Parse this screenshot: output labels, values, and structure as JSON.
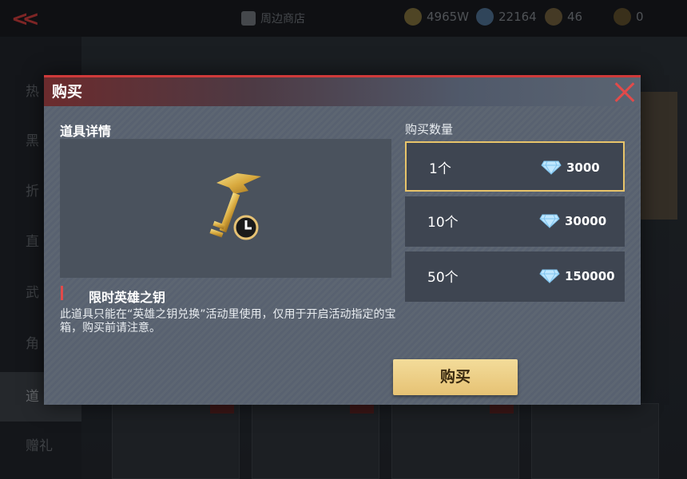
{
  "top_bar": {
    "shop_label": "周边商店",
    "currencies": [
      {
        "icon": "gold-coin-icon",
        "value": "4965W"
      },
      {
        "icon": "diamond-icon",
        "value": "22164"
      },
      {
        "icon": "cf-point-icon",
        "value": "46"
      },
      {
        "icon": "cf-coin-icon",
        "value": "0"
      }
    ]
  },
  "sidebar": {
    "items": [
      {
        "label": "热"
      },
      {
        "label": "黑"
      },
      {
        "label": "折"
      },
      {
        "label": "直"
      },
      {
        "label": "武"
      },
      {
        "label": "角"
      },
      {
        "label": "道"
      },
      {
        "label": "赠礼"
      }
    ]
  },
  "modal": {
    "title": "购买",
    "details_label": "道具详情",
    "item_name": "限时英雄之钥",
    "item_description": "此道具只能在“英雄之钥兑换”活动里使用，仅用于开启活动指定的宝箱，购买前请注意。",
    "quantity_label": "购买数量",
    "options": [
      {
        "count": "1个",
        "price": "3000",
        "selected": true
      },
      {
        "count": "10个",
        "price": "30000",
        "selected": false
      },
      {
        "count": "50个",
        "price": "150000",
        "selected": false
      }
    ],
    "buy_label": "购买"
  },
  "colors": {
    "accent_red": "#e24a4a",
    "selected_border": "#e8c46a",
    "buy_button": "#eccc82"
  }
}
